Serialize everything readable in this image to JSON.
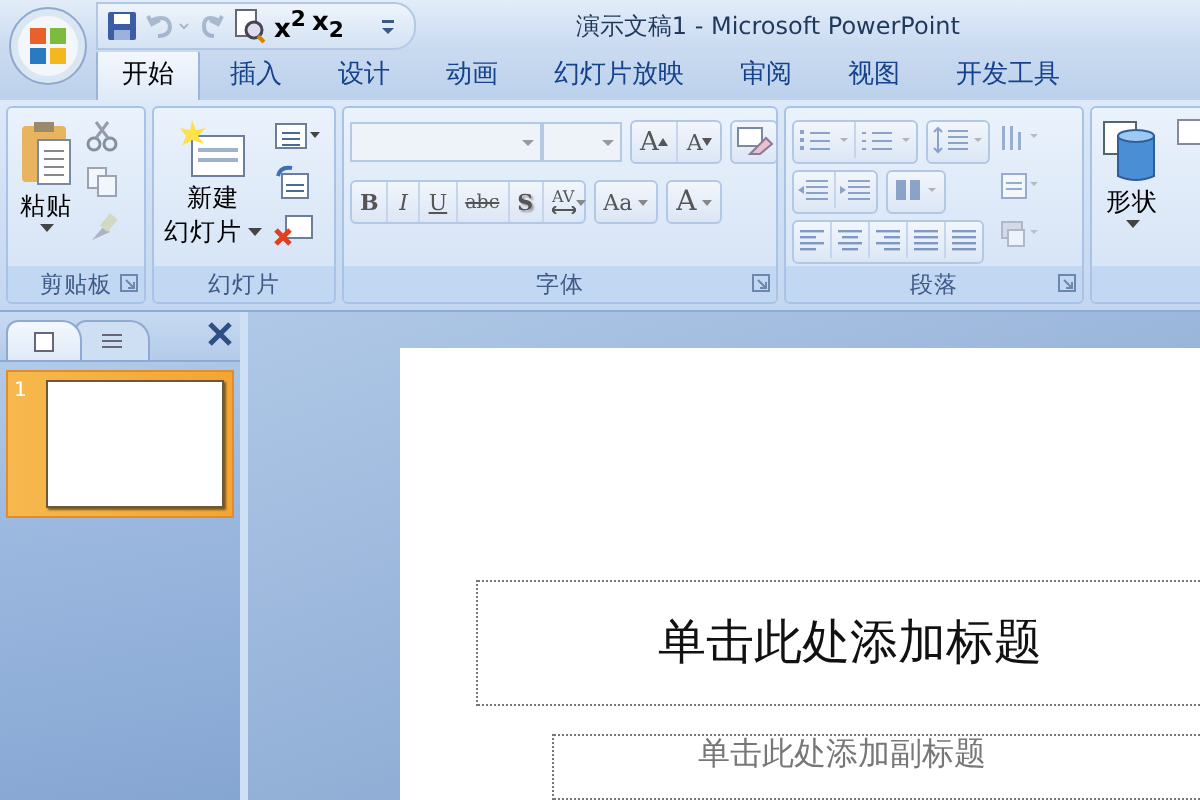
{
  "window": {
    "title": "演示文稿1 - Microsoft PowerPoint"
  },
  "quick_access": [
    {
      "kind": "save",
      "disabled": false
    },
    {
      "kind": "undo",
      "disabled": true
    },
    {
      "kind": "redo",
      "disabled": true
    },
    {
      "kind": "preview",
      "disabled": false
    },
    {
      "kind": "text",
      "label": "x$^{2}$",
      "disabled": false
    },
    {
      "kind": "text",
      "label": "x$_{2}$",
      "disabled": false
    },
    {
      "kind": "customize",
      "disabled": false
    }
  ],
  "tabs": [
    {
      "label": "开始",
      "selected": true
    },
    {
      "label": "插入",
      "selected": false
    },
    {
      "label": "设计",
      "selected": false
    },
    {
      "label": "动画",
      "selected": false
    },
    {
      "label": "幻灯片放映",
      "selected": false
    },
    {
      "label": "审阅",
      "selected": false
    },
    {
      "label": "视图",
      "selected": false
    },
    {
      "label": "开发工具",
      "selected": false
    }
  ],
  "ribbon": {
    "clipboard": {
      "title": "剪贴板",
      "launcher": true,
      "paste_label": "粘贴"
    },
    "slides": {
      "title": "幻灯片",
      "new_slide_lines": [
        "新建",
        "幻灯片"
      ]
    },
    "font": {
      "title": "字体",
      "launcher": true,
      "size_buttons": [
        {
          "label": "A",
          "kind": "grow"
        },
        {
          "label": "A",
          "kind": "shrink"
        }
      ],
      "format_buttons": [
        {
          "label": "B",
          "kind": "bold"
        },
        {
          "label": "I",
          "kind": "italic"
        },
        {
          "label": "U",
          "kind": "underline"
        },
        {
          "label": "abc",
          "kind": "strike"
        },
        {
          "label": "S",
          "kind": "shadow"
        },
        {
          "label": "AV",
          "kind": "spacing"
        },
        {
          "label": "Aa",
          "kind": "case"
        },
        {
          "label": "A",
          "kind": "color"
        }
      ]
    },
    "paragraph": {
      "title": "段落",
      "launcher": true
    },
    "drawing": {
      "shape_label": "形状"
    }
  },
  "pane": {
    "tabs": [
      {
        "kind": "slides",
        "selected": true
      },
      {
        "kind": "outline",
        "selected": false
      }
    ],
    "thumbnails": [
      {
        "number": "1",
        "selected": true
      }
    ]
  },
  "slide": {
    "title_placeholder": "单击此处添加标题",
    "subtitle_placeholder": "单击此处添加副标题"
  }
}
